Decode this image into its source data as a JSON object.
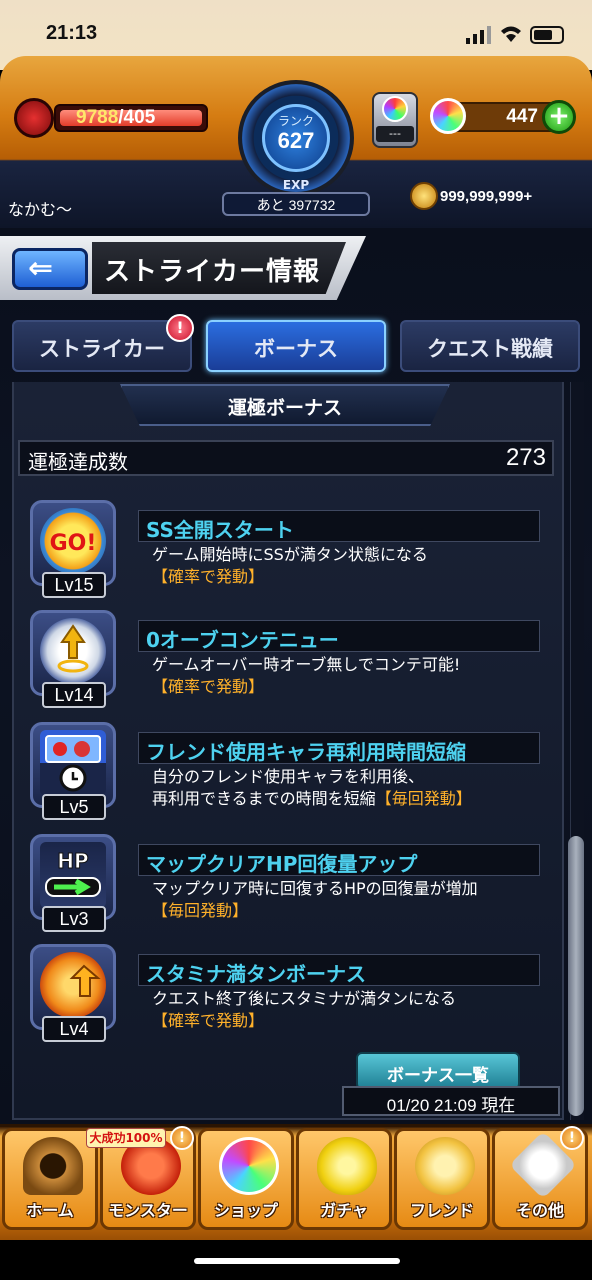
{
  "status_bar": {
    "time": "21:13"
  },
  "header": {
    "hp_current": "9788",
    "hp_max": "/405",
    "rank_label": "ランク",
    "rank": "627",
    "exp_label": "EXP",
    "exp_remaining": "あと 397732",
    "item_count": "---",
    "orbs": "447",
    "player_name": "なかむ〜",
    "coins": "999,999,999+"
  },
  "title": {
    "text": "ストライカー情報",
    "back_icon": "back-arrow-icon"
  },
  "tabs": [
    {
      "label": "ストライカー",
      "active": false,
      "alert": "!"
    },
    {
      "label": "ボーナス",
      "active": true
    },
    {
      "label": "クエスト戦績",
      "active": false
    }
  ],
  "section": {
    "title": "運極ボーナス"
  },
  "unkyoku": {
    "label": "運極達成数",
    "value": "273"
  },
  "bonuses": [
    {
      "icon": "go-icon",
      "level": "Lv15",
      "name": "SS全開スタート",
      "desc1": "ゲーム開始時にSSが満タン状態になる",
      "desc2": "",
      "tag": "【確率で発動】"
    },
    {
      "icon": "orb-wings-icon",
      "level": "Lv14",
      "name": "0オーブコンテニュー",
      "desc1": "ゲームオーバー時オーブ無しでコンテ可能!",
      "desc2": "",
      "tag": "【確率で発動】"
    },
    {
      "icon": "friend-clock-icon",
      "level": "Lv5",
      "name": "フレンド使用キャラ再利用時間短縮",
      "desc1": "自分のフレンド使用キャラを利用後、",
      "desc2": "再利用できるまでの時間を短縮",
      "tag": "【毎回発動】"
    },
    {
      "icon": "hp-arrow-icon",
      "level": "Lv3",
      "name": "マップクリアHP回復量アップ",
      "desc1": "マップクリア時に回復するHPの回復量が増加",
      "desc2": "",
      "tag": "【毎回発動】"
    },
    {
      "icon": "stamina-icon",
      "level": "Lv4",
      "name": "スタミナ満タンボーナス",
      "desc1": "クエスト終了後にスタミナが満タンになる",
      "desc2": "",
      "tag": "【確率で発動】"
    }
  ],
  "footer": {
    "list_button": "ボーナス一覧",
    "timestamp": "01/20 21:09 現在"
  },
  "nav": [
    {
      "label": "ホーム",
      "icon": "home-gate-icon"
    },
    {
      "label": "モンスター",
      "icon": "monster-icon",
      "badge": "大成功100%",
      "alert": "!"
    },
    {
      "label": "ショップ",
      "icon": "rainbow-orb-icon"
    },
    {
      "label": "ガチャ",
      "icon": "gacha-egg-icon"
    },
    {
      "label": "フレンド",
      "icon": "friends-icon"
    },
    {
      "label": "その他",
      "icon": "other-menu-icon",
      "alert": "!"
    }
  ]
}
